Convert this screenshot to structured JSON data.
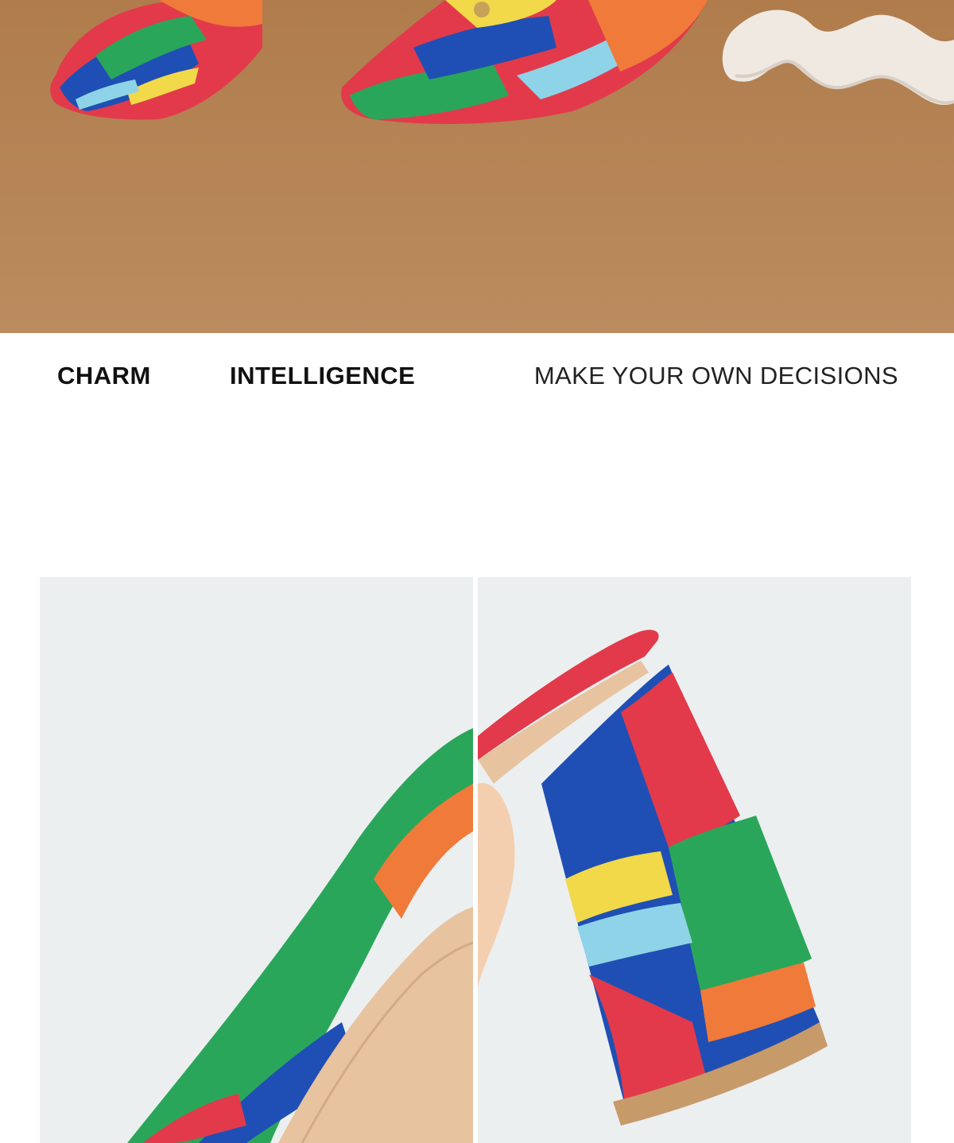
{
  "hero": {
    "alt": "Pair of multicolor printed square-toe heeled sandals on a tan paper backdrop with a white wavy display stand",
    "colors": {
      "backdrop": "#b78657",
      "stand": "#efe9e2"
    }
  },
  "taglines": {
    "items": [
      {
        "text": "CHARM",
        "style": "bold"
      },
      {
        "text": "INTELLIGENCE",
        "style": "bold"
      },
      {
        "text": "MAKE YOUR OWN DECISIONS",
        "style": "light"
      }
    ]
  },
  "details": {
    "left": {
      "alt": "Close-up of printed sandal strap and nude insole",
      "background": "#eceff0"
    },
    "right": {
      "alt": "Close-up of printed block heel",
      "background": "#eceff0"
    }
  },
  "print_colors": [
    "#e23a4b",
    "#1f4fb4",
    "#2aa65a",
    "#f1d94a",
    "#8fd3e8",
    "#f07a3a"
  ]
}
